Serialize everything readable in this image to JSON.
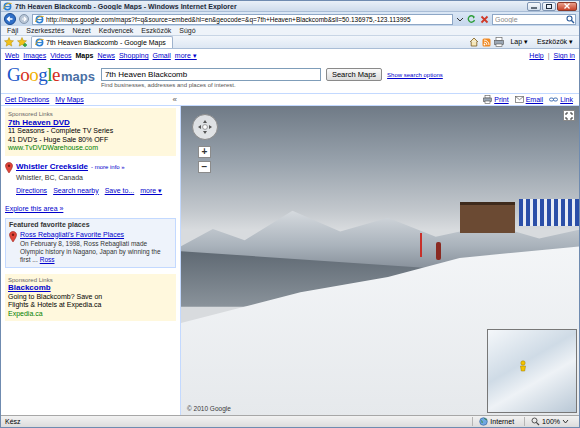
{
  "window": {
    "title": "7th Heaven Blackcomb - Google Maps - Windows Internet Explorer"
  },
  "address_bar": {
    "url": "http://maps.google.com/maps?f=q&source=embed&hl=en&geocode=&q=7th+Heaven+Blackcomb&sll=50.136975,-123.113995",
    "search_placeholder": "Google"
  },
  "menu": [
    "Fájl",
    "Szerkesztés",
    "Nézet",
    "Kedvencek",
    "Eszközök",
    "Súgó"
  ],
  "tab": {
    "label": "7th Heaven Blackcomb - Google Maps",
    "selected": true
  },
  "command_bar": [
    "Lap ▾",
    "Eszközök ▾"
  ],
  "google_nav": {
    "links": [
      {
        "label": "Web",
        "selected": false
      },
      {
        "label": "Images",
        "selected": false
      },
      {
        "label": "Videos",
        "selected": false
      },
      {
        "label": "Maps",
        "selected": true
      },
      {
        "label": "News",
        "selected": false
      },
      {
        "label": "Shopping",
        "selected": false
      },
      {
        "label": "Gmail",
        "selected": false
      },
      {
        "label": "more ▾",
        "selected": false
      }
    ],
    "right": [
      "Help",
      "Sign in"
    ],
    "separator": "|"
  },
  "logo": {
    "text": "Google",
    "suffix": "maps"
  },
  "search": {
    "value": "7th Heaven Blackcomb",
    "button": "Search Maps",
    "options": "Show search options",
    "hint": "Find businesses, addresses and places of interest."
  },
  "toolbar": {
    "left": [
      "Get Directions",
      "My Maps"
    ],
    "collapse": "«",
    "right": [
      "Print",
      "Email",
      "Link"
    ]
  },
  "sidebar": {
    "ads_top": {
      "heading": "Sponsored Links",
      "title": "7th Heaven DVD",
      "lines": [
        "11 Seasons - Complete TV Series",
        "41 DVD's - Huge Sale 80% OFF"
      ],
      "url": "www.TvDVDWarehouse.com"
    },
    "result": {
      "title": "Whistler Creekside",
      "more": "- more info »",
      "address": "Whistler, BC, Canada",
      "actions": [
        "Directions",
        "Search nearby",
        "Save to...",
        "more ▾"
      ]
    },
    "explore": "Explore this area »",
    "featured": {
      "heading": "Featured favorite places",
      "title": "Ross Rebagliati's Favorite Places",
      "text": "On February 8, 1998, Ross Rebagliati made Olympic history in Nagano, Japan by winning the first ...",
      "link": "Ross"
    },
    "ads_bottom": {
      "heading": "Sponsored Links",
      "title": "Blackcomb",
      "lines": [
        "Going to Blackcomb? Save on",
        "Flights & Hotels at Expedia.ca"
      ],
      "url": "Expedia.ca"
    }
  },
  "map": {
    "zoom_in": "+",
    "zoom_out": "−",
    "copyright": "© 2010 Google"
  },
  "status_bar": {
    "text": "Kész",
    "zone": "Internet",
    "zoom": "100%"
  }
}
